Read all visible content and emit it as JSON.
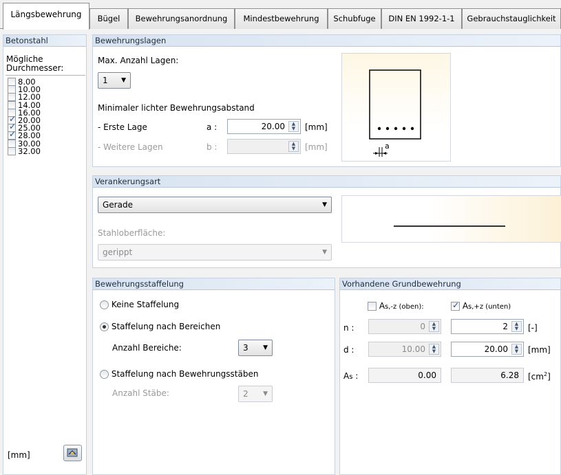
{
  "tabs": [
    {
      "label": "Längsbewehrung",
      "active": true
    },
    {
      "label": "Bügel"
    },
    {
      "label": "Bewehrungsanordnung"
    },
    {
      "label": "Mindestbewehrung"
    },
    {
      "label": "Schubfuge"
    },
    {
      "label": "DIN EN 1992-1-1"
    },
    {
      "label": "Gebrauchstauglichkeit"
    }
  ],
  "betonstahl": {
    "title": "Betonstahl",
    "label": "Mögliche Durchmesser:",
    "diameters": [
      {
        "value": "8.00",
        "checked": false
      },
      {
        "value": "10.00",
        "checked": false
      },
      {
        "value": "12.00",
        "checked": false
      },
      {
        "value": "14.00",
        "checked": false
      },
      {
        "value": "16.00",
        "checked": false
      },
      {
        "value": "20.00",
        "checked": true
      },
      {
        "value": "25.00",
        "checked": true
      },
      {
        "value": "28.00",
        "checked": true
      },
      {
        "value": "30.00",
        "checked": false
      },
      {
        "value": "32.00",
        "checked": false
      }
    ],
    "unit": "[mm]",
    "unit_button_icon": "unit-settings-icon"
  },
  "lagen": {
    "title": "Bewehrungslagen",
    "max_label": "Max. Anzahl Lagen:",
    "max_value": "1",
    "min_abstand_label": "Minimaler lichter Bewehrungsabstand",
    "erste_label": "- Erste Lage",
    "erste_sym": "a :",
    "erste_value": "20.00",
    "erste_unit": "[mm]",
    "weitere_label": "- Weitere Lagen",
    "weitere_sym": "b :",
    "weitere_value": "",
    "weitere_unit": "[mm]",
    "diagram_label": "a"
  },
  "verankerung": {
    "title": "Verankerungsart",
    "type": "Gerade",
    "surface_label": "Stahloberfläche:",
    "surface": "gerippt"
  },
  "staffelung": {
    "title": "Bewehrungsstaffelung",
    "opt_none": "Keine Staffelung",
    "opt_bereiche": "Staffelung nach Bereichen",
    "bereiche_label": "Anzahl Bereiche:",
    "bereiche_value": "3",
    "opt_staebe": "Staffelung nach Bewehrungsstäben",
    "staebe_label": "Anzahl Stäbe:",
    "staebe_value": "2"
  },
  "grund": {
    "title": "Vorhandene Grundbewehrung",
    "col_oben_main": "A",
    "col_oben_sub": "s,-z (oben):",
    "col_unten_main": "A",
    "col_unten_sub": "s,+z (unten)",
    "n_label": "n :",
    "n_oben": "0",
    "n_unten": "2",
    "n_unit": "[-]",
    "d_label": "d :",
    "d_oben": "10.00",
    "d_unten": "20.00",
    "d_unit": "[mm]",
    "as_main": "A",
    "as_sub": "s",
    "as_colon": " :",
    "as_oben": "0.00",
    "as_unten": "6.28",
    "as_unit_main": "[cm",
    "as_unit_sup": "2",
    "as_unit_end": "]"
  }
}
